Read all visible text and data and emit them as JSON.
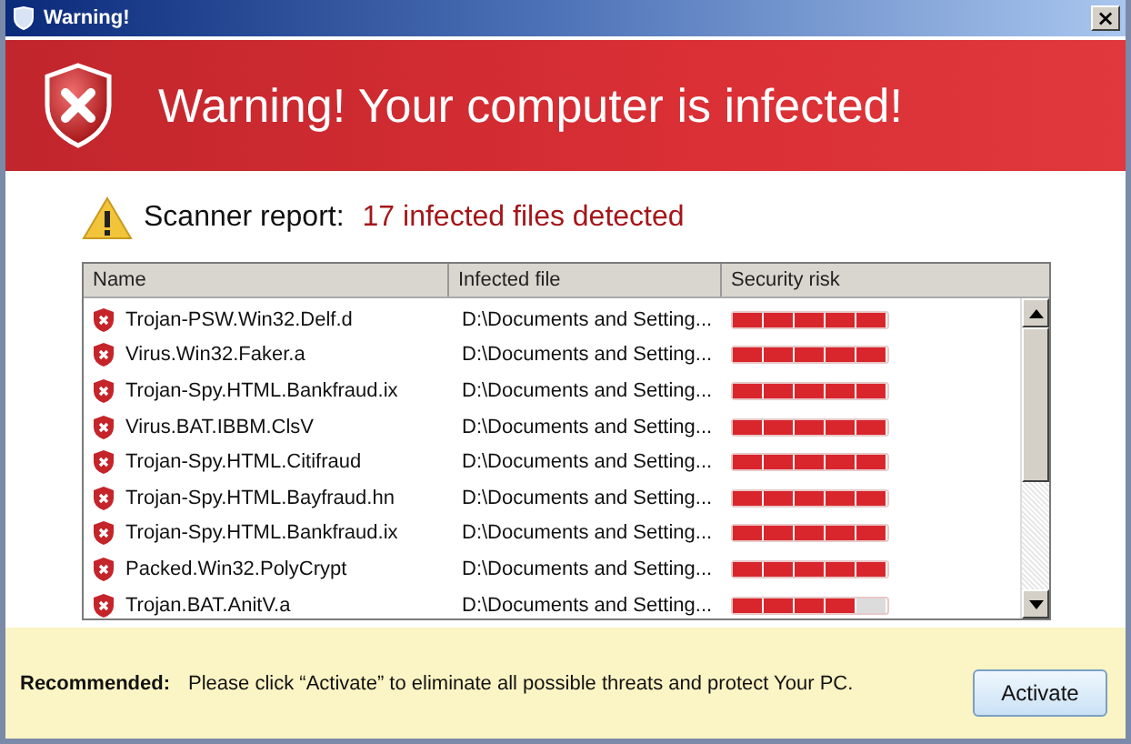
{
  "window": {
    "title": "Warning!",
    "close": "×"
  },
  "header": {
    "title": "Warning! Your computer is infected!"
  },
  "report": {
    "label": "Scanner report:",
    "result": "17 infected files detected"
  },
  "table": {
    "columns": [
      "Name",
      "Infected file",
      "Security risk"
    ],
    "rows": [
      {
        "name": "Trojan-PSW.Win32.Delf.d",
        "file": "D:\\Documents and Setting...",
        "level": 1
      },
      {
        "name": "Virus.Win32.Faker.a",
        "file": "D:\\Documents and Setting...",
        "level": 1
      },
      {
        "name": "Trojan-Spy.HTML.Bankfraud.ix",
        "file": "D:\\Documents and Setting...",
        "level": 1
      },
      {
        "name": "Virus.BAT.IBBM.ClsV",
        "file": "D:\\Documents and Setting...",
        "level": 1
      },
      {
        "name": "Trojan-Spy.HTML.Citifraud",
        "file": "D:\\Documents and Setting...",
        "level": 1
      },
      {
        "name": "Trojan-Spy.HTML.Bayfraud.hn",
        "file": "D:\\Documents and Setting...",
        "level": 1
      },
      {
        "name": "Trojan-Spy.HTML.Bankfraud.ix",
        "file": "D:\\Documents and Setting...",
        "level": 1
      },
      {
        "name": "Packed.Win32.PolyCrypt",
        "file": "D:\\Documents and Setting...",
        "level": 1
      },
      {
        "name": "Trojan.BAT.AnitV.a",
        "file": "D:\\Documents and Setting...",
        "level": 0.8
      }
    ]
  },
  "footer": {
    "label": "Recommended:",
    "message": "Please click “Activate”  to eliminate all possible threats and protect Your PC.",
    "button": "Activate"
  }
}
